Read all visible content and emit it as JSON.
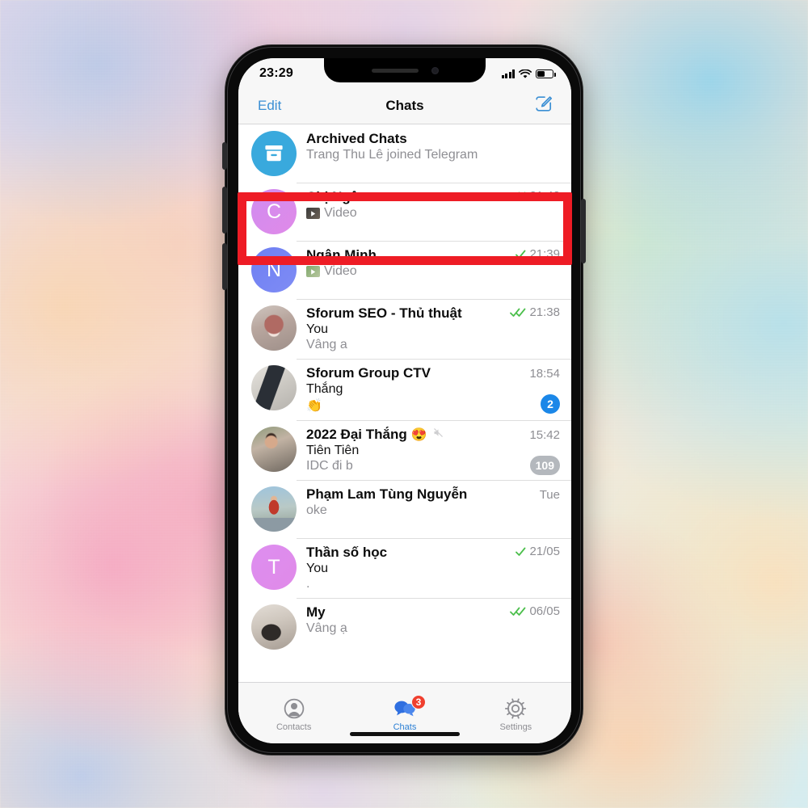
{
  "status_bar": {
    "time": "23:29",
    "signal_icon": "cellular-signal-icon",
    "wifi_icon": "wifi-icon",
    "battery_icon": "battery-icon",
    "battery_level_percent": 45
  },
  "nav_bar": {
    "edit_label": "Edit",
    "title": "Chats",
    "compose_icon": "compose-icon"
  },
  "colors": {
    "accent_blue": "#3b8fd4",
    "badge_blue": "#1b87e8",
    "badge_gray": "#b4b8bd",
    "badge_red": "#f03f2e",
    "check_green": "#4cbf4c",
    "highlight_red": "#ee1c25",
    "archived_blue": "#39a9dd"
  },
  "chats": [
    {
      "name": "Archived Chats",
      "avatar_type": "icon",
      "avatar_icon": "archive-box-icon",
      "avatar_color": "#39a9dd",
      "sender": "",
      "preview": "Trang Thu Lê joined Telegram",
      "time": "",
      "ticks": "",
      "badge": "",
      "title_emoji": "",
      "muted": false,
      "attachment": ""
    },
    {
      "name": "Chị Ngân",
      "avatar_type": "initial",
      "avatar_initial": "C",
      "avatar_color": "#d08cf0",
      "avatar_color2": "#e08ae8",
      "sender": "",
      "preview": "Video",
      "time": "21:42",
      "ticks": "double",
      "badge": "",
      "title_emoji": "",
      "muted": false,
      "attachment": "video-thumbnail"
    },
    {
      "name": "Ngân Minh",
      "avatar_type": "initial",
      "avatar_initial": "N",
      "avatar_color": "#6e7ff2",
      "avatar_color2": "#7f8cf5",
      "sender": "",
      "preview": "Video",
      "time": "21:39",
      "ticks": "single",
      "badge": "",
      "title_emoji": "",
      "muted": false,
      "attachment": "video-thumbnail"
    },
    {
      "name": "Sforum SEO - Thủ thuật",
      "avatar_type": "photo",
      "avatar_photo": "plush-toy-photo",
      "sender": "You",
      "preview": "Vâng a",
      "time": "21:38",
      "ticks": "double",
      "badge": "",
      "title_emoji": "",
      "muted": false,
      "attachment": ""
    },
    {
      "name": "Sforum Group CTV",
      "avatar_type": "photo",
      "avatar_photo": "phone-in-hand-photo",
      "sender": "Thắng",
      "preview": "👏",
      "time": "18:54",
      "ticks": "",
      "badge": "2",
      "badge_color": "#1b87e8",
      "title_emoji": "",
      "muted": false,
      "attachment": ""
    },
    {
      "name": "2022 Đại Thắng",
      "avatar_type": "photo",
      "avatar_photo": "person-photo",
      "sender": "Tiên Tiên",
      "preview": "IDC đi b",
      "time": "15:42",
      "ticks": "",
      "badge": "109",
      "badge_color": "#b4b8bd",
      "title_emoji": "😍",
      "muted": true,
      "attachment": ""
    },
    {
      "name": "Phạm Lam Tùng Nguyễn",
      "avatar_type": "photo",
      "avatar_photo": "man-in-red-jacket-photo",
      "sender": "",
      "preview": "oke",
      "time": "Tue",
      "ticks": "",
      "badge": "",
      "title_emoji": "",
      "muted": false,
      "attachment": ""
    },
    {
      "name": "Thần số học",
      "avatar_type": "initial",
      "avatar_initial": "T",
      "avatar_color": "#dd8ef0",
      "avatar_color2": "#e08ae8",
      "sender": "You",
      "preview": ".",
      "time": "21/05",
      "ticks": "single",
      "badge": "",
      "title_emoji": "",
      "muted": false,
      "attachment": ""
    },
    {
      "name": "My",
      "avatar_type": "photo",
      "avatar_photo": "dog-photo",
      "sender": "",
      "preview": "Vâng ạ",
      "time": "06/05",
      "ticks": "double",
      "badge": "",
      "title_emoji": "",
      "muted": false,
      "attachment": ""
    }
  ],
  "tab_bar": {
    "tabs": [
      {
        "label": "Contacts",
        "icon": "person-circle-icon",
        "active": false,
        "badge": ""
      },
      {
        "label": "Chats",
        "icon": "chat-bubbles-icon",
        "active": true,
        "badge": "3"
      },
      {
        "label": "Settings",
        "icon": "gear-icon",
        "active": false,
        "badge": ""
      }
    ]
  },
  "annotation": {
    "highlight_label": "red-highlight-rectangle",
    "highlights_chat": "Chị Ngân"
  }
}
